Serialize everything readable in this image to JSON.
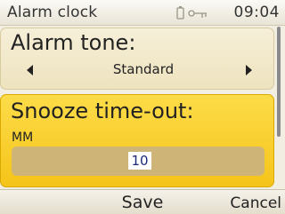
{
  "header": {
    "title": "Alarm clock",
    "time": "09:04",
    "icons": [
      "battery-icon",
      "bluetooth-icon"
    ]
  },
  "alarm_tone": {
    "label": "Alarm tone:",
    "value": "Standard"
  },
  "snooze": {
    "label": "Snooze time-out:",
    "unit": "MM",
    "value": "10"
  },
  "softkeys": {
    "save": "Save",
    "cancel": "Cancel"
  },
  "colors": {
    "highlight": "#f5c41a",
    "panel": "#eee3bf"
  }
}
